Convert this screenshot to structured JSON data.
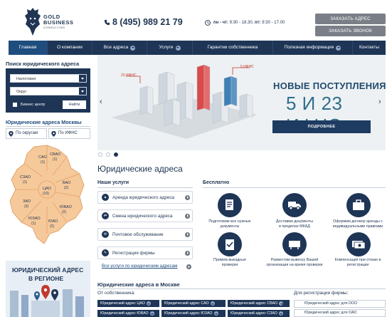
{
  "header": {
    "logo_line1": "GOLD",
    "logo_line2": "BUSINESS",
    "logo_line3": "CONSULTING",
    "phone": "8 (495) 989 21 79",
    "hours_days1": "пн - чт:",
    "hours_time1": "9:30 - 18.30,",
    "hours_days2": "пт:",
    "hours_time2": "9:30 - 17.00",
    "order_address_button": "ЗАКАЗАТЬ АДРЕС",
    "order_call_button": "ЗАКАЗАТЬ ЗВОНОК"
  },
  "nav": {
    "items": [
      "Главная",
      "О компании",
      "Все адреса",
      "Услуги",
      "Гарантии собственника",
      "Полезная информация",
      "Контакты"
    ],
    "active": "Главная"
  },
  "sidebar": {
    "search_title": "Поиск юридического адреса",
    "select_tax": "Налоговая",
    "select_district": "Округ",
    "business_center_label": "Бизнес центр",
    "find_button": "Найти",
    "moscow_title": "Юридические адреса Москвы",
    "tab_districts": "По округам",
    "tab_ifns": "По ИФНС",
    "map_labels": [
      "САО",
      "(1)",
      "СВАО",
      "(1)",
      "СЗАО",
      "(1)",
      "ВАО",
      "(2)",
      "ЦАО",
      "(10)",
      "ЗАО",
      "(3)",
      "ЮВАО",
      "(2)",
      "ЮЗАО",
      "(1)",
      "ЮАО",
      "(2)"
    ],
    "promo_line1": "ЮРИДИЧЕСКИЙ АДРЕС",
    "promo_line2": "В РЕГИОНЕ"
  },
  "slider": {
    "label_23": "23 ИФНС",
    "label_5": "5 ИФНС",
    "headline": "НОВЫЕ ПОСТУПЛЕНИЯ",
    "headline_big": "5 И 23 ИФНС",
    "more_button": "ПОДРОБНЕЕ",
    "prev": "‹",
    "next": "›"
  },
  "main": {
    "title": "Юридические адреса",
    "services_title": "Наши услуги",
    "services": [
      "Аренда юридического адреса",
      "Смена юридического адреса",
      "Почтовое обслуживание",
      "Регистрация фирмы"
    ],
    "services_all": "Все услуги по юридическим адресам",
    "free_title": "Бесплатно",
    "free_items": [
      {
        "l1": "Подготовим все нужные",
        "l2": "документы"
      },
      {
        "l1": "Доставим документы",
        "l2": "в пределах МКАД"
      },
      {
        "l1": "Оформим договор аренды с",
        "l2": "индивидуальными правками"
      },
      {
        "l1": "Примем выездные",
        "l2": "проверки"
      },
      {
        "l1": "Разместим вывеску Вашей",
        "l2": "организации на время проверки"
      },
      {
        "l1": "Компенсация при отказе в",
        "l2": "регистрации"
      }
    ],
    "moscow_title": "Юридические адреса в Москве",
    "from_owner": "От собственника:",
    "for_registration": "Для регистрации фирмы:",
    "owner_chips_row1": [
      "Юридический адрес ЦАО",
      "Юридический адрес САО",
      "Юридический адрес СВАО"
    ],
    "owner_chips_row2": [
      "Юридический адрес ЮВАО",
      "Юридический адрес ЮЗАО",
      "Юридический адрес СЗАО"
    ],
    "registration_chips": [
      "Юридический адрес для ООО",
      "Юридический адрес для ОАО"
    ]
  }
}
